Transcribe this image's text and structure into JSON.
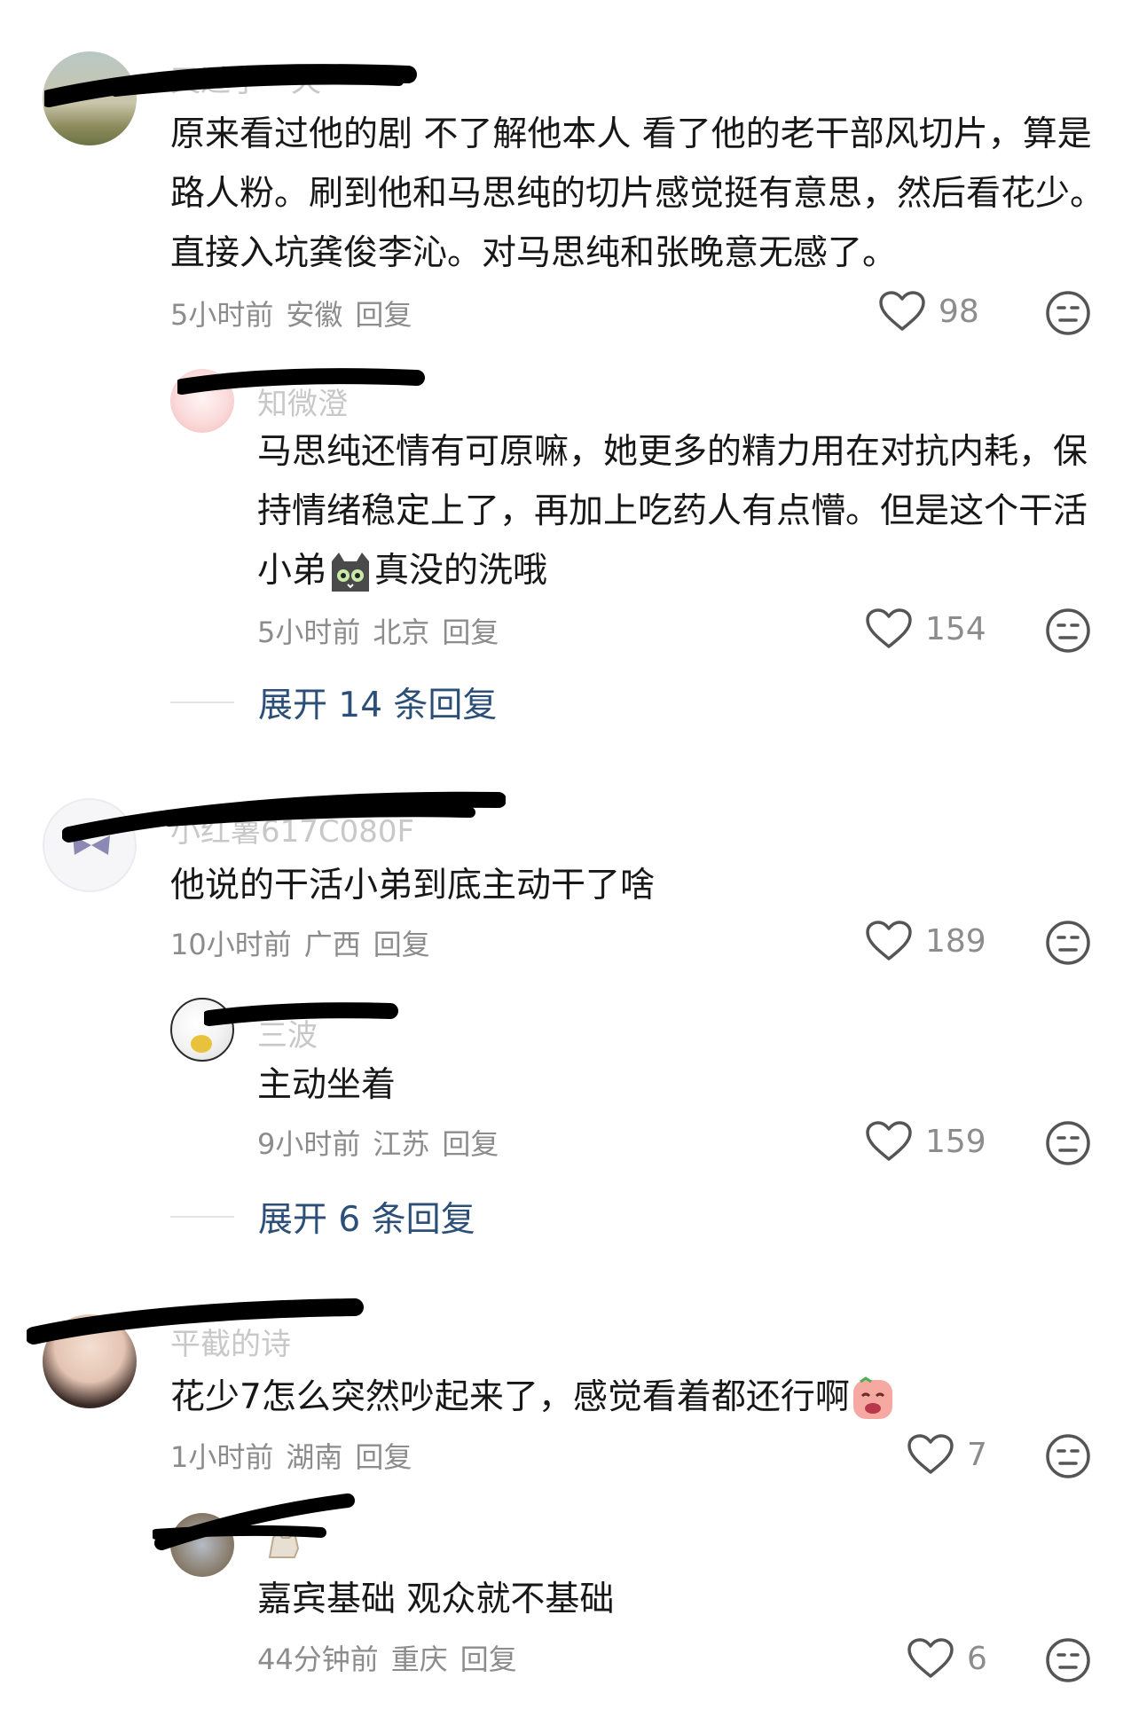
{
  "comments": [
    {
      "username": "又过了一天",
      "text": "原来看过他的剧 不了解他本人 看了他的老干部风切片，算是路人粉。刷到他和马思纯的切片感觉挺有意思，然后看花少。直接入坑龚俊李沁。对马思纯和张晚意无感了。",
      "time": "5小时前",
      "location": "安徽",
      "reply_label": "回复",
      "likes": "98",
      "avatar_colors": [
        "#9fb3b0",
        "#d4c49a",
        "#7d8a5a"
      ]
    },
    {
      "username": "知微澄",
      "text_before_emoji": "马思纯还情有可原嘛，她更多的精力用在对抗内耗，保持情绪稳定上了，再加上吃药人有点懵。但是这个干活小弟",
      "emoji": "cat-emoji",
      "text_after_emoji": "真没的洗哦",
      "time": "5小时前",
      "location": "北京",
      "reply_label": "回复",
      "likes": "154",
      "avatar_colors": [
        "#fbe3e3",
        "#f3b8b8"
      ]
    },
    {
      "expand_label": "展开 14 条回复"
    },
    {
      "username": "小红薯617C080F",
      "text": "他说的干活小弟到底主动干了啥",
      "time": "10小时前",
      "location": "广西",
      "reply_label": "回复",
      "likes": "189",
      "avatar_colors": [
        "#f4f4f7",
        "#5d5a8a"
      ]
    },
    {
      "username": "三波",
      "text": "主动坐着",
      "time": "9小时前",
      "location": "江苏",
      "reply_label": "回复",
      "likes": "159",
      "avatar_colors": [
        "#ffffff",
        "#e7c23a"
      ]
    },
    {
      "expand_label": "展开 6 条回复"
    },
    {
      "username": "平截的诗",
      "text": "花少7怎么突然吵起来了，感觉看着都还行啊",
      "emoji": "crying-face-emoji",
      "time": "1小时前",
      "location": "湖南",
      "reply_label": "回复",
      "likes": "7",
      "avatar_colors": [
        "#e8d2c6",
        "#3a2a26"
      ]
    },
    {
      "username": "",
      "text": "嘉宾基础 观众就不基础",
      "time": "44分钟前",
      "location": "重庆",
      "reply_label": "回复",
      "likes": "6",
      "avatar_colors": [
        "#a0a9b5",
        "#6b5b45"
      ]
    }
  ],
  "icons": {
    "like": "heart-outline-icon",
    "dislike": "neutral-face-icon"
  },
  "colors": {
    "link": "#2c4f78",
    "meta": "#8c8c8c",
    "scribble": "#000000"
  }
}
